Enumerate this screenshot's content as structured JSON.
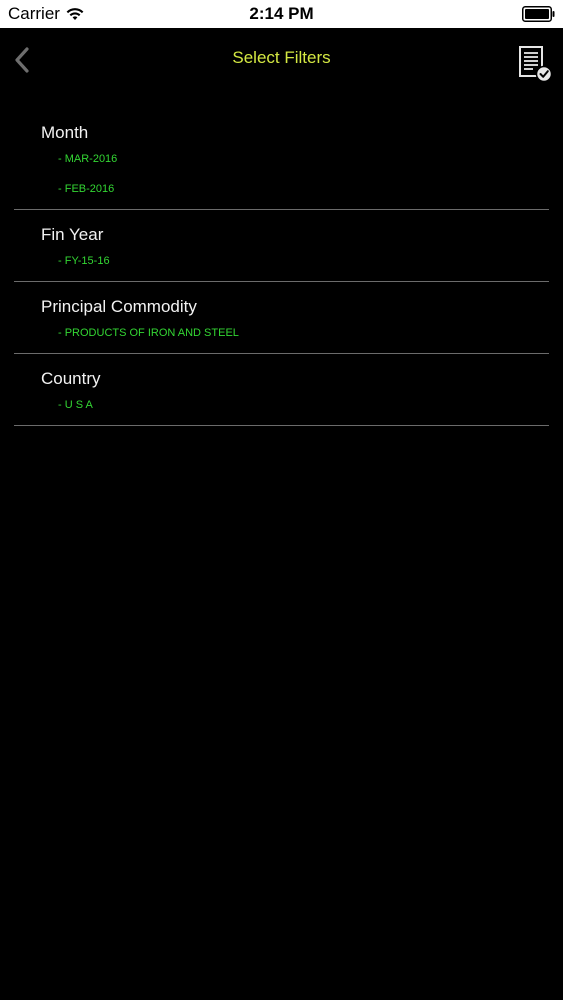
{
  "status_bar": {
    "carrier": "Carrier",
    "time": "2:14 PM"
  },
  "nav": {
    "title": "Select Filters",
    "back_icon": "chevron-left-icon",
    "apply_icon": "document-check-icon",
    "title_color": "#d4e842"
  },
  "filters": [
    {
      "title": "Month",
      "values": [
        "- MAR-2016",
        "- FEB-2016"
      ]
    },
    {
      "title": "Fin Year",
      "values": [
        "- FY-15-16"
      ]
    },
    {
      "title": "Principal Commodity",
      "values": [
        "- PRODUCTS OF IRON AND STEEL"
      ]
    },
    {
      "title": "Country",
      "values": [
        "- U S A"
      ]
    }
  ],
  "colors": {
    "background": "#000000",
    "value_text": "#33d633",
    "divider": "#6b6b6b"
  }
}
